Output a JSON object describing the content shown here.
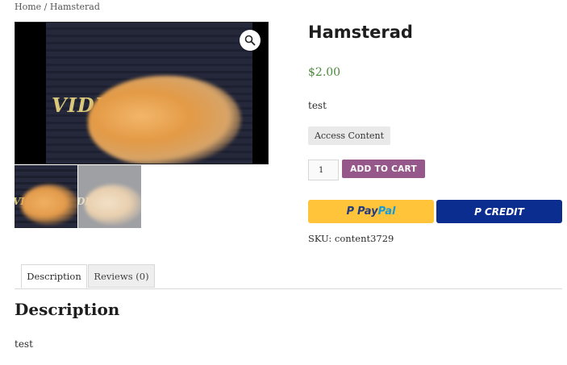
{
  "breadcrumb": {
    "home": "Home",
    "separator": " / ",
    "current": "Hamsterad"
  },
  "gallery": {
    "main_alt": "VIDE",
    "thumb_text_1": "VIDE",
    "thumb_text_2": "DE",
    "zoom_icon": "magnifier-icon"
  },
  "product": {
    "title": "Hamsterad",
    "price": "$2.00",
    "short_description": "test",
    "access_button": "Access Content",
    "quantity": "1",
    "add_to_cart": "ADD TO CART",
    "sku_label": "SKU:",
    "sku_value": "content3729"
  },
  "payments": {
    "paypal_part1": "Pay",
    "paypal_part2": "Pal",
    "credit_label": "CREDIT",
    "paypal_color": "#ffc439",
    "credit_color": "#0b2d8f"
  },
  "tabs": [
    {
      "label": "Description"
    },
    {
      "label": "Reviews (0)"
    }
  ],
  "description": {
    "heading": "Description",
    "body": "test"
  },
  "colors": {
    "price": "#4e8a3d",
    "add_to_cart": "#96588a"
  }
}
